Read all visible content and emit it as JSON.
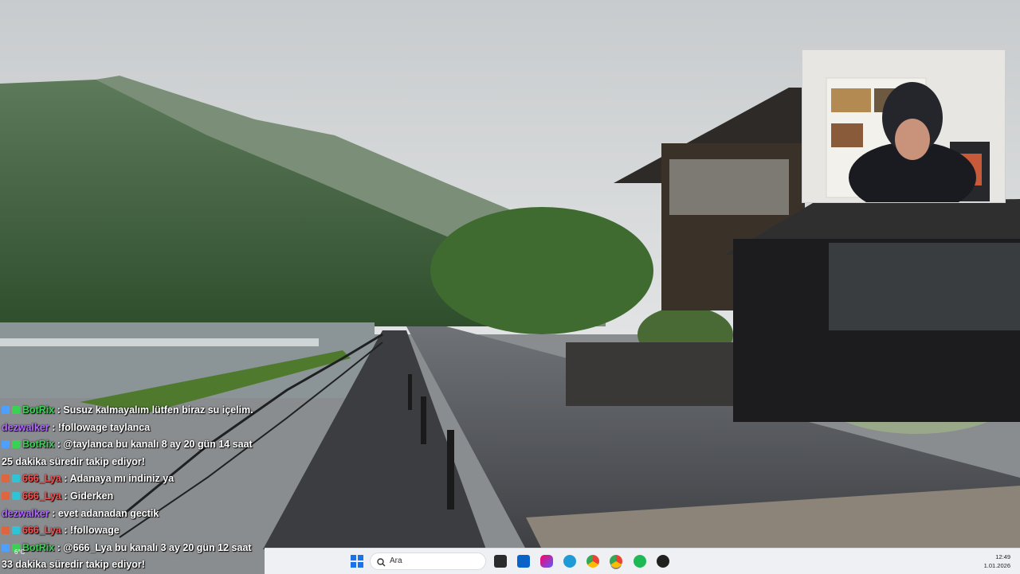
{
  "chat": {
    "messages": [
      {
        "user": "BotRix",
        "color": "#39d353",
        "text": "Susuz kalmayalım lütfen biraz su içelim.",
        "badges": [
          "bot",
          "verified"
        ]
      },
      {
        "user": "dezwalker",
        "color": "#b26bff",
        "text": "!followage taylanca",
        "badges": []
      },
      {
        "user": "BotRix",
        "color": "#39d353",
        "text": "@taylanca bu kanalı 8 ay 20 gün 14 saat 25 dakika süredir takip ediyor!",
        "badges": [
          "bot",
          "verified"
        ]
      },
      {
        "user": "666_Lya",
        "color": "#ff4b4b",
        "text": "Adanaya mı indiniz ya",
        "badges": [
          "heart",
          "sub"
        ]
      },
      {
        "user": "666_Lya",
        "color": "#ff4b4b",
        "text": "Giderken",
        "badges": [
          "heart",
          "sub"
        ]
      },
      {
        "user": "dezwalker",
        "color": "#b26bff",
        "text": "evet adanadan gectik",
        "badges": []
      },
      {
        "user": "666_Lya",
        "color": "#ff4b4b",
        "text": "!followage",
        "badges": [
          "heart",
          "sub"
        ]
      },
      {
        "user": "BotRix",
        "color": "#39d353",
        "text": "@666_Lya bu kanalı 3 ay 20 gün 12 saat 33 dakika süredir takip ediyor!",
        "badges": [
          "bot",
          "verified"
        ]
      }
    ],
    "separator": ":"
  },
  "taskbar": {
    "search_label": "Ara",
    "time": "12:49",
    "date": "1.01.2026",
    "weather": "6°C",
    "apps": [
      "windows-start-icon",
      "file-explorer-icon",
      "outlook-icon",
      "copilot-icon",
      "edge-icon",
      "chrome-icon",
      "chrome-icon",
      "spotify-icon",
      "obs-icon"
    ]
  },
  "colors": {
    "botrix": "#39d353",
    "dezwalker": "#b26bff",
    "lya": "#ff4b4b",
    "taskbar_bg": "#eef0f4"
  }
}
